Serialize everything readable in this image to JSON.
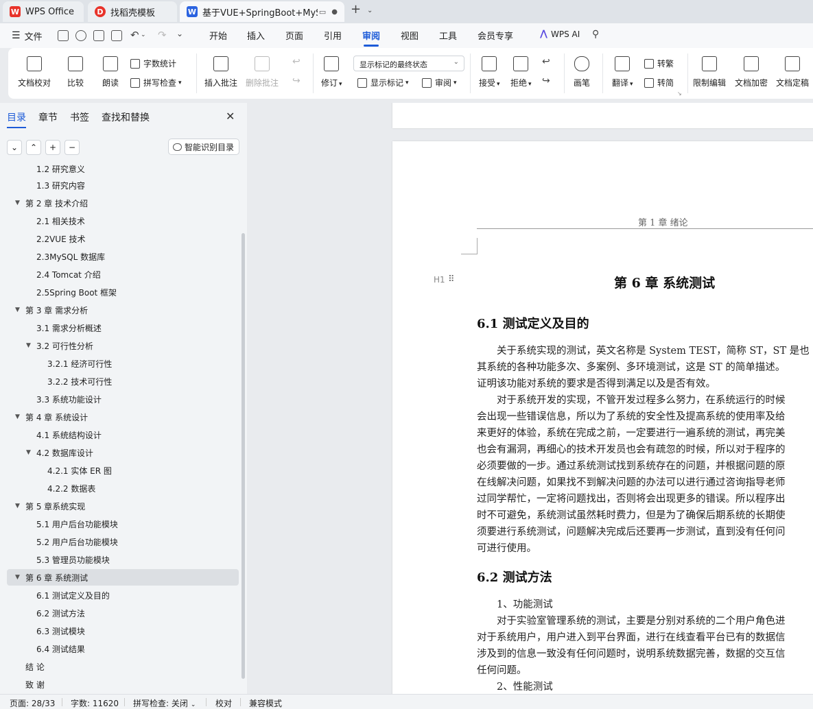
{
  "tabs": [
    {
      "label": "WPS Office",
      "logo": "W"
    },
    {
      "label": "找稻壳模板",
      "logo": "D"
    },
    {
      "label": "基于VUE+SpringBoot+MySQ",
      "logo": "W"
    }
  ],
  "menu": {
    "file": "文件",
    "tabs": [
      "开始",
      "插入",
      "页面",
      "引用",
      "审阅",
      "视图",
      "工具",
      "会员专享"
    ],
    "active_tab": "审阅",
    "wps_ai": "WPS AI"
  },
  "ribbon": {
    "doc_check": "文档校对",
    "compare": "比较",
    "read_aloud": "朗读",
    "word_count": "字数统计",
    "spell_check": "拼写检查",
    "insert_comment": "插入批注",
    "delete_comment": "删除批注",
    "revise": "修订",
    "display_state": "显示标记的最终状态",
    "show_markup": "显示标记",
    "review": "审阅",
    "accept": "接受",
    "reject": "拒绝",
    "pen": "画笔",
    "translate": "翻译",
    "to_traditional": "转繁",
    "to_simplified": "转简",
    "restrict_edit": "限制编辑",
    "encrypt": "文档加密",
    "finalize": "文档定稿"
  },
  "nav": {
    "tabs": [
      "目录",
      "章节",
      "书签",
      "查找和替换"
    ],
    "smart_toc": "智能识别目录",
    "toc": [
      "1.2 研究意义",
      "1.3 研究内容",
      "第 2 章  技术介绍",
      "2.1 相关技术",
      "2.2VUE 技术",
      "2.3MySQL 数据库",
      "2.4 Tomcat 介绍",
      "2.5Spring Boot 框架",
      "第 3 章  需求分析",
      "3.1 需求分析概述",
      "3.2 可行性分析",
      "3.2.1 经济可行性",
      "3.2.2 技术可行性",
      "3.3 系统功能设计",
      "第 4 章  系统设计",
      "4.1 系统结构设计",
      "4.2 数据库设计",
      "4.2.1 实体 ER 图",
      "4.2.2 数据表",
      "第 5 章系统实现",
      "5.1 用户后台功能模块",
      "5.2 用户后台功能模块",
      "5.3 管理员功能模块",
      "第 6 章  系统测试",
      "6.1 测试定义及目的",
      "6.2 测试方法",
      "6.3 测试模块",
      "6.4 测试结果",
      "结  论",
      "致  谢"
    ]
  },
  "doc": {
    "header": "第 1 章  绪论",
    "h1_marker": "H1",
    "chapter_title": "第 6 章  系统测试",
    "sec1": "6.1 测试定义及目的",
    "p1": [
      "　　关于系统实现的测试，英文名称是 System TEST，简称 ST，ST 是也",
      "其系统的各种功能多次、多案例、多环境测试，这是 ST 的简单描述。",
      "证明该功能对系统的要求是否得到满足以及是否有效。"
    ],
    "p2": [
      "　　对于系统开发的实现，不管开发过程多么努力，在系统运行的时候",
      "会出现一些错误信息，所以为了系统的安全性及提高系统的使用率及给",
      "来更好的体验，系统在完成之前，一定要进行一遍系统的测试，再完美",
      "也会有漏洞，再细心的技术开发员也会有疏忽的时候，所以对于程序的",
      "必须要做的一步。通过系统测试找到系统存在的问题，并根据问题的原",
      "在线解决问题，如果找不到解决问题的办法可以进行通过咨询指导老师",
      "过同学帮忙，一定将问题找出，否则将会出现更多的错误。所以程序出",
      "时不可避免，系统测试虽然耗时费力，但是为了确保后期系统的长期使",
      "须要进行系统测试，问题解决完成后还要再一步测试，直到没有任何问",
      "可进行使用。"
    ],
    "sec2": "6.2 测试方法",
    "p3": [
      "　　1、功能测试",
      "　　对于实验室管理系统的测试，主要是分别对系统的二个用户角色进",
      "对于系统用户，用户进入到平台界面，进行在线查看平台已有的数据信",
      "涉及到的信息一致没有任何问题时，说明系统数据完善，数据的交互信",
      "任何问题。",
      "　　2、性能测试"
    ]
  },
  "status": {
    "page": "页面: 28/33",
    "words": "字数: 11620",
    "spell": "拼写检查: 关闭",
    "proof": "校对",
    "compat": "兼容模式"
  }
}
